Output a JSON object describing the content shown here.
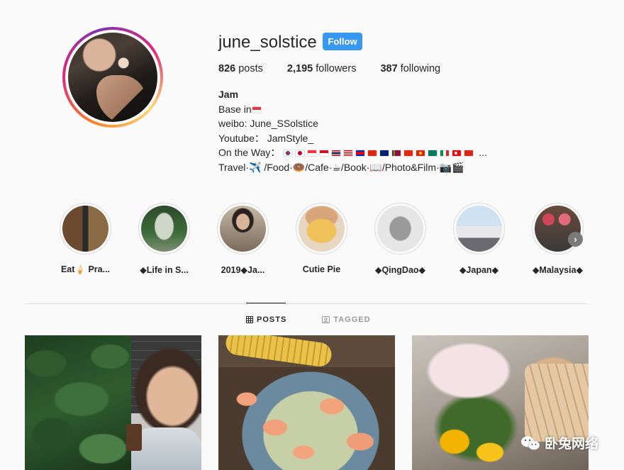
{
  "profile": {
    "username": "june_solstice",
    "follow_label": "Follow",
    "stats": {
      "posts_count": "826",
      "posts_label": "posts",
      "followers_count": "2,195",
      "followers_label": "followers",
      "following_count": "387",
      "following_label": "following"
    },
    "bio": {
      "name": "Jam",
      "line1": "Base in",
      "line2": "weibo: June_SSolstice",
      "line3": "Youtube： JamStyle_",
      "line4": "On the Way：",
      "line4_suffix": "...",
      "line5": "Travel·✈️ /Food·🍩/Cafe·☕/Book·📖/Photo&Film·📷🎬"
    }
  },
  "highlights": [
    {
      "label": "Eat🍦 Pra...",
      "colors": [
        "#6b4a2f",
        "#8a6a45"
      ]
    },
    {
      "label": "◆Life in S...",
      "colors": [
        "#3f6b3a",
        "#cfd8c8"
      ]
    },
    {
      "label": "2019◆Ja...",
      "colors": [
        "#7a6a5a",
        "#c6b9a6"
      ]
    },
    {
      "label": "Cutie Pie",
      "colors": [
        "#f2c25a",
        "#e7d6c2"
      ]
    },
    {
      "label": "◆QingDao◆",
      "colors": [
        "#d8d8d8",
        "#9a9a9a"
      ]
    },
    {
      "label": "◆Japan◆",
      "colors": [
        "#cfe2f2",
        "#6a6a70"
      ]
    },
    {
      "label": "◆Malaysia◆",
      "colors": [
        "#d1475a",
        "#3a3a3a"
      ]
    }
  ],
  "tabs": {
    "posts": "POSTS",
    "tagged": "TAGGED"
  },
  "watermark": {
    "text": "卧兔网络"
  },
  "colors": {
    "follow_button": "#3897f0",
    "background": "#fafafa",
    "text": "#262626",
    "divider": "#dbdbdb"
  }
}
